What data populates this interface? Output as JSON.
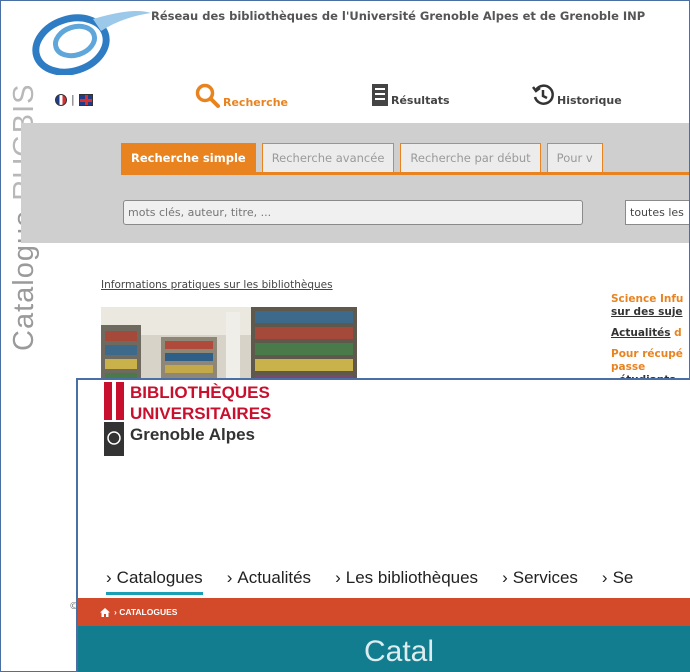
{
  "old_catalogue": {
    "site_title": "Réseau des bibliothèques de l'Université Grenoble Alpes et de Grenoble INP",
    "lang_separator": "|",
    "nav": {
      "recherche": "Recherche",
      "resultats": "Résultats",
      "historique": "Historique"
    },
    "sidebar": {
      "word1": "Catalogue",
      "word2": "RUGBIS"
    },
    "search_tabs": [
      "Recherche simple",
      "Recherche avancée",
      "Recherche par début",
      "Pour v"
    ],
    "search_placeholder": "mots clés, auteur, titre, ...",
    "scope_value": "toutes les",
    "info_link": "Informations pratiques sur les bibliothèques",
    "right_column": {
      "line1": "Science Infu",
      "line2": "sur des suje",
      "line3a": "Actualités",
      "line3b": " d",
      "line4": "Pour récupé",
      "line5": "passe",
      "line6": "- étudiants"
    },
    "copyright": "©",
    "accent_color": "#e8831f"
  },
  "new_site": {
    "logo": {
      "line1": "BIBLIOTHÈQUES",
      "line2": "UNIVERSITAIRES",
      "line3": "Grenoble Alpes"
    },
    "nav_items": [
      "Catalogues",
      "Actualités",
      "Les bibliothèques",
      "Services",
      "Se"
    ],
    "nav_arrow": "›",
    "breadcrumb": "› CATALOGUES",
    "hero_title": "Catal",
    "brand_red": "#c8102e",
    "breadcrumb_color": "#d24a2a",
    "hero_color": "#127d8f"
  }
}
